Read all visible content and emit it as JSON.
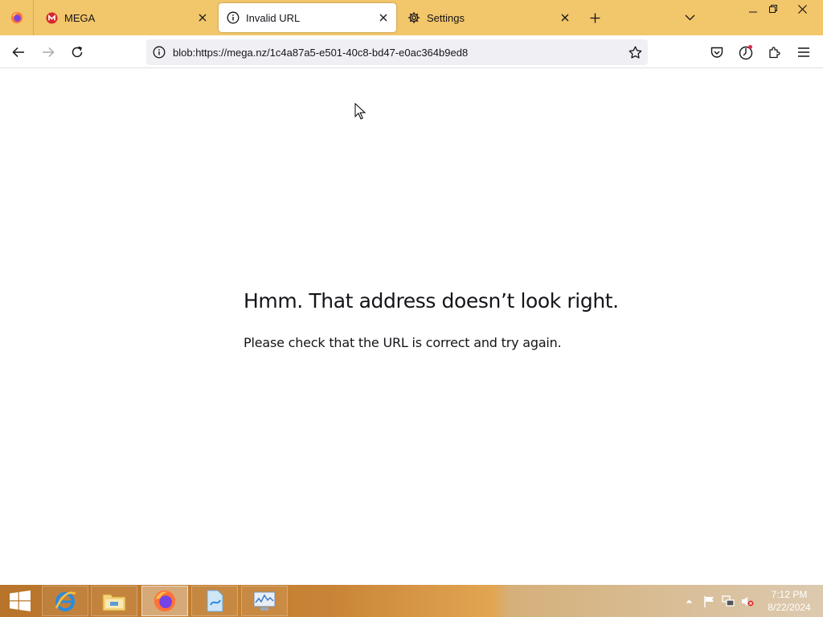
{
  "tabs": [
    {
      "label": "MEGA",
      "icon": "mega-icon"
    },
    {
      "label": "Invalid URL",
      "icon": "info-icon",
      "active": true
    },
    {
      "label": "Settings",
      "icon": "gear-icon"
    }
  ],
  "toolbar": {
    "url": "blob:https://mega.nz/1c4a87a5-e501-40c8-bd47-e0ac364b9ed8"
  },
  "error": {
    "title": "Hmm. That address doesn’t look right.",
    "description": "Please check that the URL is correct and try again."
  },
  "taskbar": {
    "time": "7:12 PM",
    "date": "8/22/2024",
    "apps": [
      "internet-explorer-icon",
      "file-explorer-icon",
      "firefox-icon",
      "app-icon",
      "task-manager-icon"
    ]
  },
  "colors": {
    "tabbar": "#f2c66a",
    "accent_mega": "#d9272e",
    "text": "#15141a"
  }
}
